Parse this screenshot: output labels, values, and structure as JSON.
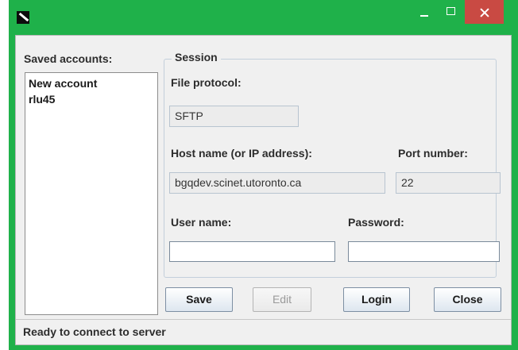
{
  "window": {
    "icons": {
      "app": "app-icon",
      "minimize": "minimize-icon",
      "maximize": "maximize-icon",
      "close": "close-icon"
    },
    "accent_color": "#1fb14a",
    "close_color": "#c94a43"
  },
  "saved_accounts": {
    "label": "Saved accounts:",
    "items": [
      "New account",
      "rlu45"
    ]
  },
  "session": {
    "legend": "Session",
    "file_protocol_label": "File protocol:",
    "file_protocol_value": "SFTP",
    "host_label": "Host name (or IP address):",
    "host_value": "bgqdev.scinet.utoronto.ca",
    "port_label": "Port number:",
    "port_value": "22",
    "username_label": "User name:",
    "username_value": "",
    "password_label": "Password:",
    "password_value": ""
  },
  "buttons": {
    "save": "Save",
    "edit": "Edit",
    "login": "Login",
    "close": "Close"
  },
  "status": {
    "text": "Ready to connect to server"
  }
}
